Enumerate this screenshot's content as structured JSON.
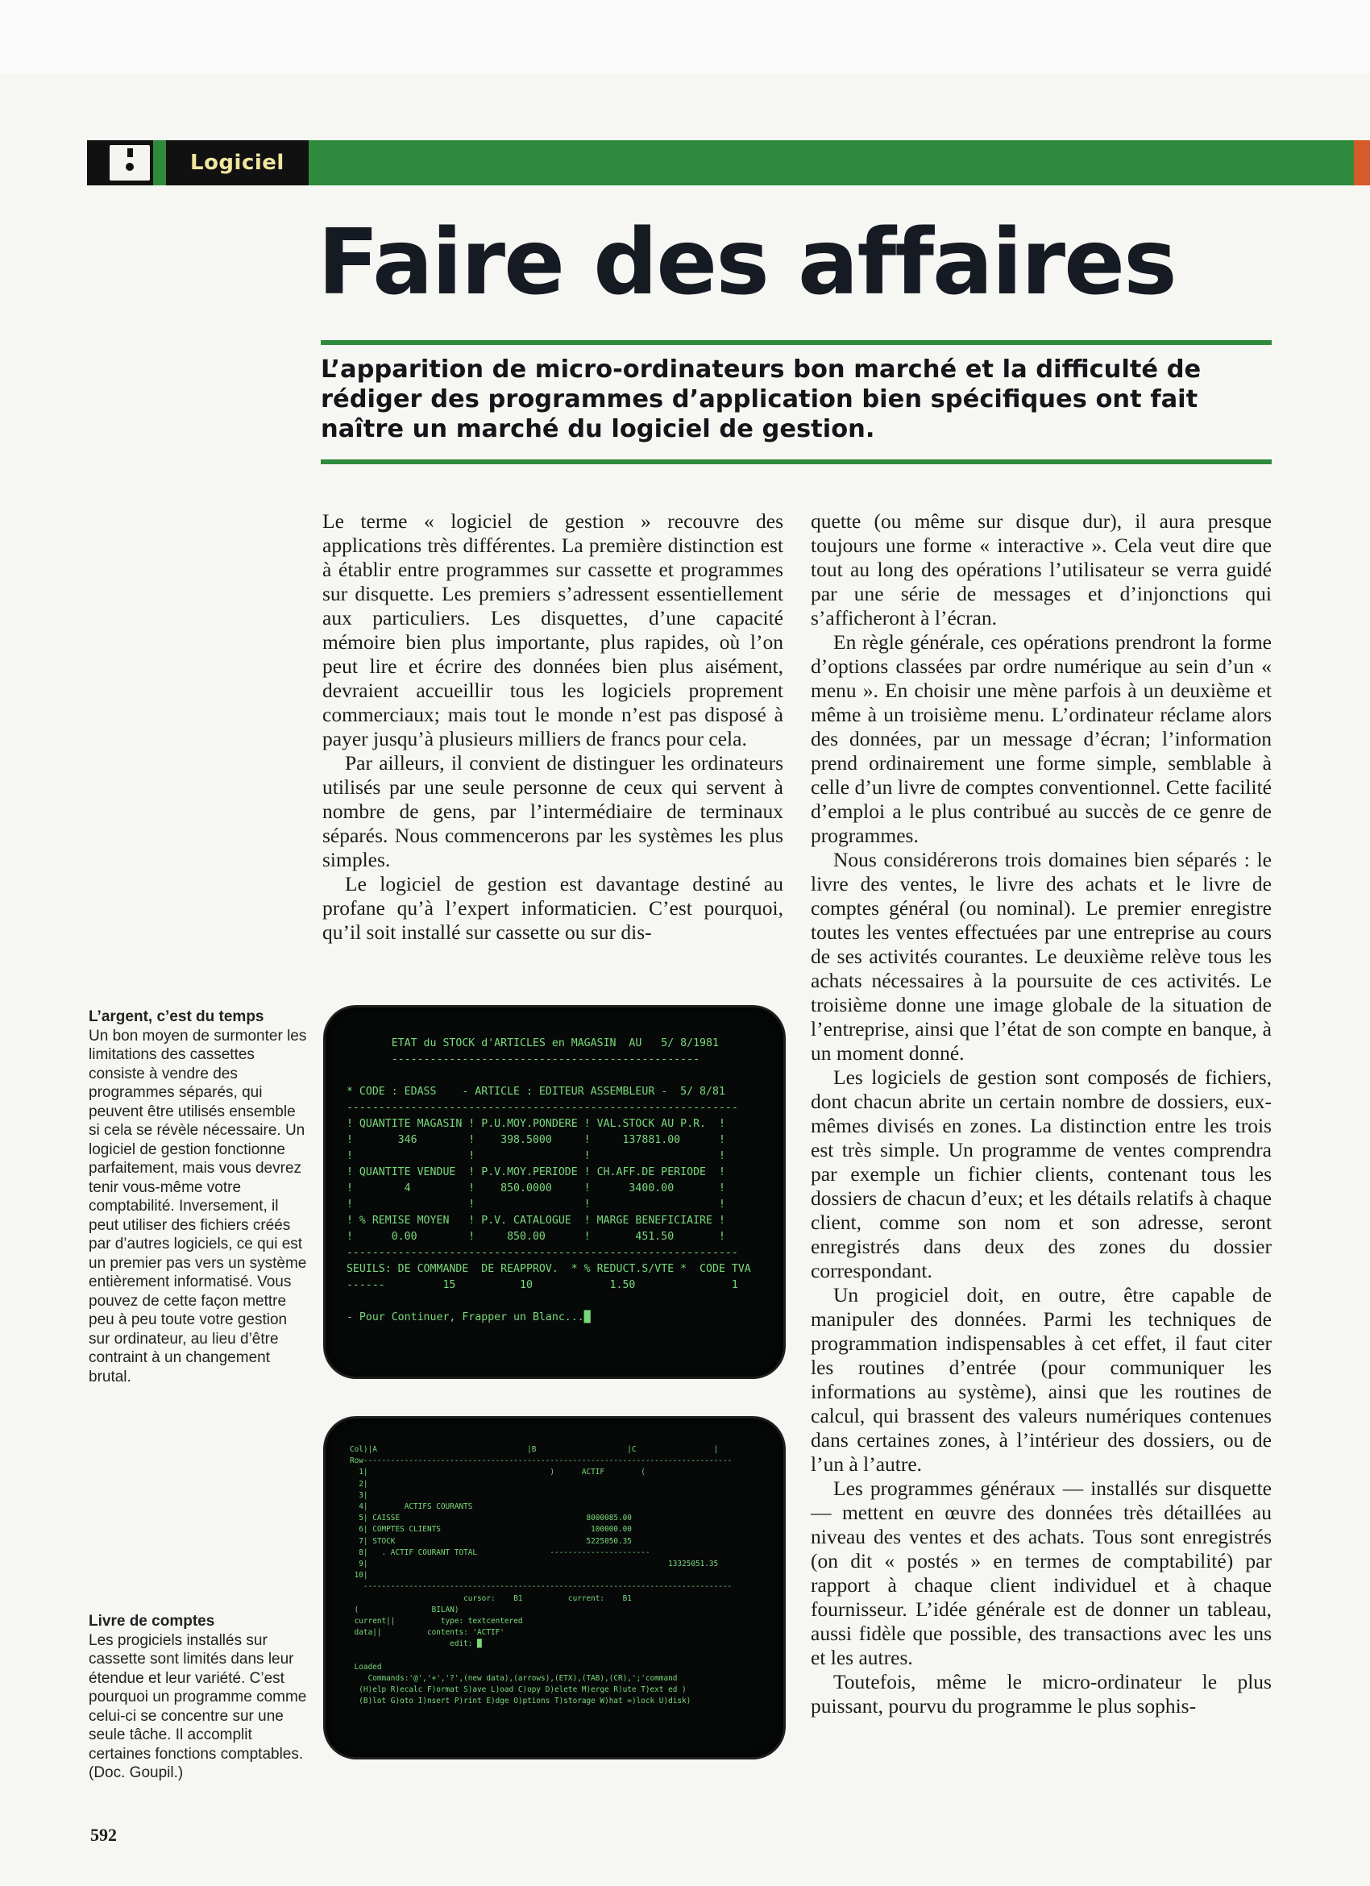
{
  "header": {
    "section_label": "Logiciel"
  },
  "article": {
    "title": "Faire des affaires",
    "lead": "L’apparition de micro-ordinateurs bon marché et la difficulté de rédiger des programmes d’application bien spécifiques ont fait naître un marché du logiciel de gestion.",
    "left_column": [
      "Le terme « logiciel de gestion » recouvre des applications très différentes. La première distinction est à établir entre programmes sur cassette et programmes sur disquette. Les premiers s’adressent essentiellement aux particuliers. Les disquettes, d’une capacité mémoire bien plus importante, plus rapides, où l’on peut lire et écrire des données bien plus aisément, devraient accueillir tous les logiciels proprement commerciaux; mais tout le monde n’est pas disposé à payer jusqu’à plusieurs milliers de francs pour cela.",
      "Par ailleurs, il convient de distinguer les ordinateurs utilisés par une seule personne de ceux qui servent à nombre de gens, par l’intermédiaire de terminaux séparés. Nous commencerons par les systèmes les plus simples.",
      "Le logiciel de gestion est davantage destiné au profane qu’à l’expert informaticien. C’est pourquoi, qu’il soit installé sur cassette ou sur dis-"
    ],
    "right_column": [
      "quette (ou même sur disque dur), il aura presque toujours une forme « interactive ». Cela veut dire que tout au long des opérations l’utilisateur se verra guidé par une série de messages et d’injonctions qui s’afficheront à l’écran.",
      "En règle générale, ces opérations prendront la forme d’options classées par ordre numérique au sein d’un « menu ». En choisir une mène parfois à un deuxième et même à un troisième menu. L’ordinateur réclame alors des données, par un message d’écran; l’information prend ordinairement une forme simple, semblable à celle d’un livre de comptes conventionnel. Cette facilité d’emploi a le plus contribué au succès de ce genre de programmes.",
      "Nous considérerons trois domaines bien séparés : le livre des ventes, le livre des achats et le livre de comptes général (ou nominal). Le premier enregistre toutes les ventes effectuées par une entreprise au cours de ses activités courantes. Le deuxième relève tous les achats nécessaires à la poursuite de ces activités. Le troisième donne une image globale de la situation de l’entreprise, ainsi que l’état de son compte en banque, à un moment donné.",
      "Les logiciels de gestion sont composés de fichiers, dont chacun abrite un certain nombre de dossiers, eux-mêmes divisés en zones. La distinction entre les trois est très simple. Un programme de ventes comprendra par exemple un fichier clients, contenant tous les dossiers de chacun d’eux; et les détails relatifs à chaque client, comme son nom et son adresse, seront enregistrés dans deux des zones du dossier correspondant.",
      "Un progiciel doit, en outre, être capable de manipuler des données. Parmi les techniques de programmation indispensables à cet effet, il faut citer les routines d’entrée (pour communiquer les informations au système), ainsi que les routines de calcul, qui brassent des valeurs numériques contenues dans certaines zones, à l’intérieur des dossiers, ou de l’un à l’autre.",
      "Les programmes généraux — installés sur disquette — mettent en œuvre des données très détaillées au niveau des ventes et des achats. Tous sont enregistrés (on dit « postés » en termes de comptabilité) par rapport à chaque client individuel et à chaque fournisseur. L’idée générale est de donner un tableau, aussi fidèle que possible, des transactions avec les uns et les autres.",
      "Toutefois, même le micro-ordinateur le plus puissant, pourvu du programme le plus sophis-"
    ]
  },
  "sidenotes": [
    {
      "heading": "L’argent, c’est du temps",
      "text": "Un bon moyen de surmonter les limitations des cassettes consiste à vendre des programmes séparés, qui peuvent être utilisés ensemble si cela se révèle nécessaire. Un logiciel de gestion fonctionne parfaitement, mais vous devrez tenir vous-même votre comptabilité. Inversement, il peut utiliser des fichiers créés par d’autres logiciels, ce qui est un premier pas vers un système entièrement informatisé. Vous pouvez de cette façon mettre peu à peu toute votre gestion sur ordinateur, au lieu d’être contraint à un changement brutal."
    },
    {
      "heading": "Livre de comptes",
      "text": "Les progiciels installés sur cassette sont limités dans leur étendue et leur variété. C’est pourquoi un programme comme celui-ci se concentre sur une seule tâche. Il accomplit certaines fonctions comptables. (Doc. Goupil.)"
    }
  ],
  "screens": {
    "stock_screen": "        ETAT du STOCK d'ARTICLES en MAGASIN  AU   5/ 8/1981\n        ------------------------------------------------\n\n * CODE : EDASS    - ARTICLE : EDITEUR ASSEMBLEUR -  5/ 8/81\n -------------------------------------------------------------\n ! QUANTITE MAGASIN ! P.U.MOY.PONDERE ! VAL.STOCK AU P.R.  !\n !       346        !    398.5000     !     137881.00      !\n !                  !                 !                    !\n ! QUANTITE VENDUE  ! P.V.MOY.PERIODE ! CH.AFF.DE PERIODE  !\n !        4         !    850.0000     !      3400.00       !\n !                  !                 !                    !\n ! % REMISE MOYEN   ! P.V. CATALOGUE  ! MARGE BENEFICIAIRE !\n !      0.00        !     850.00      !       451.50       !\n -------------------------------------------------------------\n SEUILS: DE COMMANDE  DE REAPPROV.  * % REDUCT.S/VTE *  CODE TVA\n ------         15          10            1.50               1\n\n - Pour Continuer, Frapper un Blanc...█",
    "spreadsheet_screen": "Col)|A                                 |B                    |C                 |\nRow---------------------------------------------------------------------------------\n  1|                                        )      ACTIF        (\n  2|\n  3|\n  4|        ACTIFS COURANTS\n  5| CAISSE                                         8000085.00\n  6| COMPTES CLIENTS                                 100000.00\n  7| STOCK                                          5225050.35\n  8|   . ACTIF COURANT TOTAL                ----------------------\n  9|                                                                  13325051.35\n 10|\n   ---------------------------------------------------------------------------------\n                         cursor:    B1          current:    B1\n (                BILAN)\n current||          type: textcentered\n data||          contents: 'ACTIF'\n                      edit: █\n\n Loaded\n    Commands:'@','+','?',(new data),(arrows),(ETX),(TAB),(CR),';'command\n  (H)elp R)ecalc F)ormat S)ave L)oad C)opy D)elete M)erge R)ute T)ext ed )\n  (B)lot G)oto I)nsert P)rint E)dge O)ptions T)storage W)hat =)lock U)disk)"
  },
  "page_number": "592",
  "colors": {
    "accent_green": "#2e8a3c",
    "header_text": "#f0e6a0",
    "screen_text": "#79d97a",
    "edge_orange": "#d65a2a"
  }
}
